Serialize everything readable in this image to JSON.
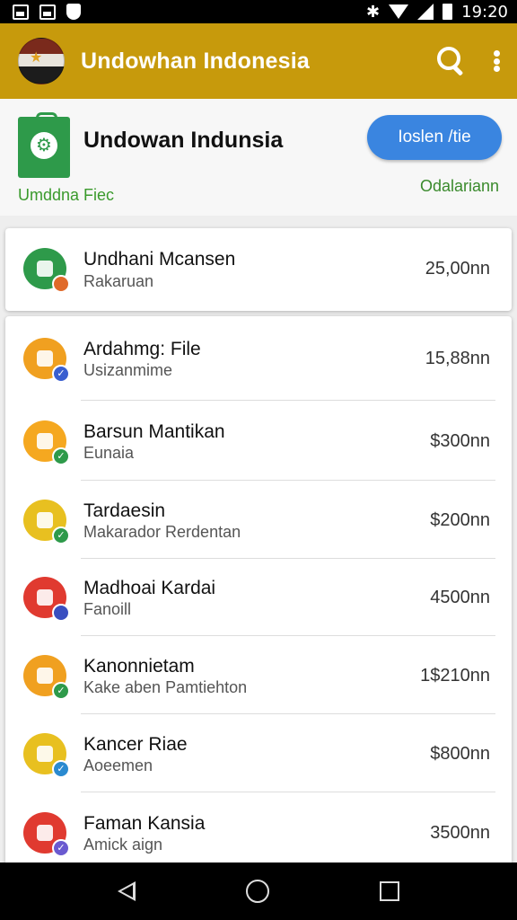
{
  "status_bar": {
    "time": "19:20",
    "icons": [
      "image-icon",
      "photo-icon",
      "shield-icon",
      "bluetooth-icon",
      "wifi-icon",
      "signal-icon",
      "battery-icon"
    ]
  },
  "app_bar": {
    "title": "Undowhan Indonesia",
    "icons": [
      "flag-logo",
      "search-icon",
      "more-vert-icon"
    ],
    "color": "#c79a0c"
  },
  "header": {
    "title": "Undowan Indunsia",
    "button_label": "Ioslen /tie",
    "subtitle_left": "Umddna Fiec",
    "subtitle_right": "Odalariann",
    "accent": "#3a85e0"
  },
  "featured": {
    "title": "Undhani Mcansen",
    "subtitle": "Rakaruan",
    "price": "25,00nn",
    "face_color": "#2e9a4a",
    "badge_color": "#e06a2a"
  },
  "items": [
    {
      "title": "Ardahmg: File",
      "subtitle": "Usizanmime",
      "price": "15,88nn",
      "face_color": "#f0a020",
      "badge_color": "#3a5fd0",
      "badge": "✓"
    },
    {
      "title": "Barsun Mantikan",
      "subtitle": "Eunaia",
      "price": "$300nn",
      "face_color": "#f5a820",
      "badge_color": "#2e9a4a",
      "badge": "✓"
    },
    {
      "title": "Tardaesin",
      "subtitle": "Makarador Rerdentan",
      "price": "$200nn",
      "face_color": "#e8c020",
      "badge_color": "#2e9a4a",
      "badge": "✓"
    },
    {
      "title": "Madhoai Kardai",
      "subtitle": "Fanoill",
      "price": "4500nn",
      "face_color": "#e03a30",
      "badge_color": "#3a4fc0",
      "badge": ""
    },
    {
      "title": "Kanonnietam",
      "subtitle": "Kake aben Pamtiehton",
      "price": "1$210nn",
      "face_color": "#f0a020",
      "badge_color": "#2e9a4a",
      "badge": "✓"
    },
    {
      "title": "Kancer Riae",
      "subtitle": "Aoeemen",
      "price": "$800nn",
      "face_color": "#e8c020",
      "badge_color": "#2a8ad0",
      "badge": "✓"
    },
    {
      "title": "Faman Kansia",
      "subtitle": "Amick aign",
      "price": "3500nn",
      "face_color": "#e03a30",
      "badge_color": "#6a5ad0",
      "badge": "✓"
    }
  ],
  "nav_bar": {
    "icons": [
      "back-icon",
      "home-icon",
      "recent-apps-icon"
    ]
  }
}
